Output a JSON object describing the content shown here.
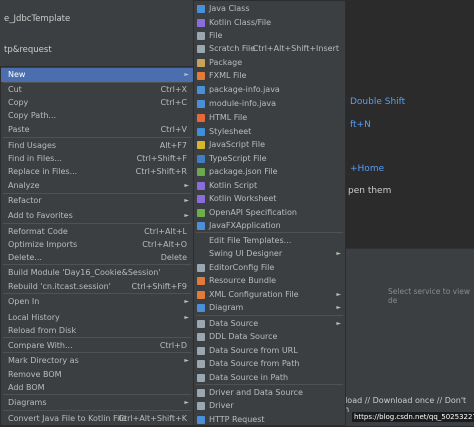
{
  "background": {
    "project_title": "e_JdbcTemplate",
    "project_sub": "tp&request",
    "hint_double_shift": "Double Shift",
    "hint_ft_n": "ft+N",
    "hint_home": "+Home",
    "hint_open_them": "pen them",
    "services_text": "Select service to view de",
    "download_text": "nload // Download once // Don't sh",
    "watermark": "https://blog.csdn.net/qq_50253227"
  },
  "context_menu": [
    {
      "label": "New",
      "shortcut": "",
      "arrow": "►",
      "selected": true
    },
    {
      "label": "Cut",
      "shortcut": "Ctrl+X"
    },
    {
      "label": "Copy",
      "shortcut": "Ctrl+C"
    },
    {
      "label": "Copy Path...",
      "shortcut": ""
    },
    {
      "label": "Paste",
      "shortcut": "Ctrl+V"
    },
    {
      "label": "Find Usages",
      "shortcut": "Alt+F7"
    },
    {
      "label": "Find in Files...",
      "shortcut": "Ctrl+Shift+F"
    },
    {
      "label": "Replace in Files...",
      "shortcut": "Ctrl+Shift+R"
    },
    {
      "label": "Analyze",
      "shortcut": "",
      "arrow": "►"
    },
    {
      "label": "Refactor",
      "shortcut": "",
      "arrow": "►"
    },
    {
      "label": "Add to Favorites",
      "shortcut": "",
      "arrow": "►"
    },
    {
      "label": "Reformat Code",
      "shortcut": "Ctrl+Alt+L"
    },
    {
      "label": "Optimize Imports",
      "shortcut": "Ctrl+Alt+O"
    },
    {
      "label": "Delete...",
      "shortcut": "Delete"
    },
    {
      "label": "Build Module 'Day16_Cookie&Session'",
      "shortcut": ""
    },
    {
      "label": "Rebuild 'cn.itcast.session'",
      "shortcut": "Ctrl+Shift+F9"
    },
    {
      "label": "Open In",
      "shortcut": "",
      "arrow": "►"
    },
    {
      "label": "Local History",
      "shortcut": "",
      "arrow": "►"
    },
    {
      "label": "Reload from Disk",
      "shortcut": ""
    },
    {
      "label": "Compare With...",
      "shortcut": "Ctrl+D"
    },
    {
      "label": "Mark Directory as",
      "shortcut": "",
      "arrow": "►"
    },
    {
      "label": "Remove BOM",
      "shortcut": ""
    },
    {
      "label": "Add BOM",
      "shortcut": ""
    },
    {
      "label": "Diagrams",
      "shortcut": "",
      "arrow": "►"
    },
    {
      "label": "Convert Java File to Kotlin File",
      "shortcut": "Ctrl+Alt+Shift+K"
    }
  ],
  "new_submenu": [
    {
      "label": "Java Class",
      "shortcut": "",
      "icon": "java-class-icon",
      "color": "#4a90d9"
    },
    {
      "label": "Kotlin Class/File",
      "shortcut": "",
      "icon": "kotlin-icon",
      "color": "#8c6cd8"
    },
    {
      "label": "File",
      "shortcut": "",
      "icon": "file-icon",
      "color": "#9aa7b0"
    },
    {
      "label": "Scratch File",
      "shortcut": "Ctrl+Alt+Shift+Insert",
      "icon": "scratch-file-icon",
      "color": "#9aa7b0"
    },
    {
      "label": "Package",
      "shortcut": "",
      "icon": "package-icon",
      "color": "#c8a35a"
    },
    {
      "label": "FXML File",
      "shortcut": "",
      "icon": "fxml-icon",
      "color": "#e07b39"
    },
    {
      "label": "package-info.java",
      "shortcut": "",
      "icon": "java-file-icon",
      "color": "#4a90d9"
    },
    {
      "label": "module-info.java",
      "shortcut": "",
      "icon": "java-file-icon",
      "color": "#4a90d9"
    },
    {
      "label": "HTML File",
      "shortcut": "",
      "icon": "html-icon",
      "color": "#e5693a"
    },
    {
      "label": "Stylesheet",
      "shortcut": "",
      "icon": "css-icon",
      "color": "#3c8fdb"
    },
    {
      "label": "JavaScript File",
      "shortcut": "",
      "icon": "js-icon",
      "color": "#d6b82d"
    },
    {
      "label": "TypeScript File",
      "shortcut": "",
      "icon": "ts-icon",
      "color": "#3f7fc0"
    },
    {
      "label": "package.json File",
      "shortcut": "",
      "icon": "json-icon",
      "color": "#6ea84e"
    },
    {
      "label": "Kotlin Script",
      "shortcut": "",
      "icon": "kotlin-script-icon",
      "color": "#8c6cd8"
    },
    {
      "label": "Kotlin Worksheet",
      "shortcut": "",
      "icon": "kotlin-worksheet-icon",
      "color": "#8c6cd8"
    },
    {
      "label": "OpenAPI Specification",
      "shortcut": "",
      "icon": "openapi-icon",
      "color": "#6cae4a"
    },
    {
      "label": "JavaFXApplication",
      "shortcut": "",
      "icon": "javafx-icon",
      "color": "#4a90d9"
    },
    {
      "label": "Edit File Templates...",
      "shortcut": "",
      "icon": "",
      "color": ""
    },
    {
      "label": "Swing UI Designer",
      "shortcut": "",
      "arrow": "►",
      "icon": "",
      "color": ""
    },
    {
      "label": "EditorConfig File",
      "shortcut": "",
      "icon": "editorconfig-icon",
      "color": "#9aa7b0"
    },
    {
      "label": "Resource Bundle",
      "shortcut": "",
      "icon": "resource-bundle-icon",
      "color": "#e07b39"
    },
    {
      "label": "XML Configuration File",
      "shortcut": "",
      "arrow": "►",
      "icon": "xml-icon",
      "color": "#e07b39"
    },
    {
      "label": "Diagram",
      "shortcut": "",
      "arrow": "►",
      "icon": "diagram-icon",
      "color": "#4a90d9"
    },
    {
      "label": "Data Source",
      "shortcut": "",
      "arrow": "►",
      "icon": "datasource-icon",
      "color": "#9aa7b0"
    },
    {
      "label": "DDL Data Source",
      "shortcut": "",
      "icon": "ddl-icon",
      "color": "#9aa7b0"
    },
    {
      "label": "Data Source from URL",
      "shortcut": "",
      "icon": "datasource-url-icon",
      "color": "#9aa7b0"
    },
    {
      "label": "Data Source from Path",
      "shortcut": "",
      "icon": "datasource-path-icon",
      "color": "#9aa7b0"
    },
    {
      "label": "Data Source in Path",
      "shortcut": "",
      "icon": "datasource-inpath-icon",
      "color": "#9aa7b0"
    },
    {
      "label": "Driver and Data Source",
      "shortcut": "",
      "icon": "driver-ds-icon",
      "color": "#9aa7b0"
    },
    {
      "label": "Driver",
      "shortcut": "",
      "icon": "driver-icon",
      "color": "#9aa7b0"
    },
    {
      "label": "HTTP Request",
      "shortcut": "",
      "icon": "http-request-icon",
      "color": "#4a90d9"
    }
  ]
}
